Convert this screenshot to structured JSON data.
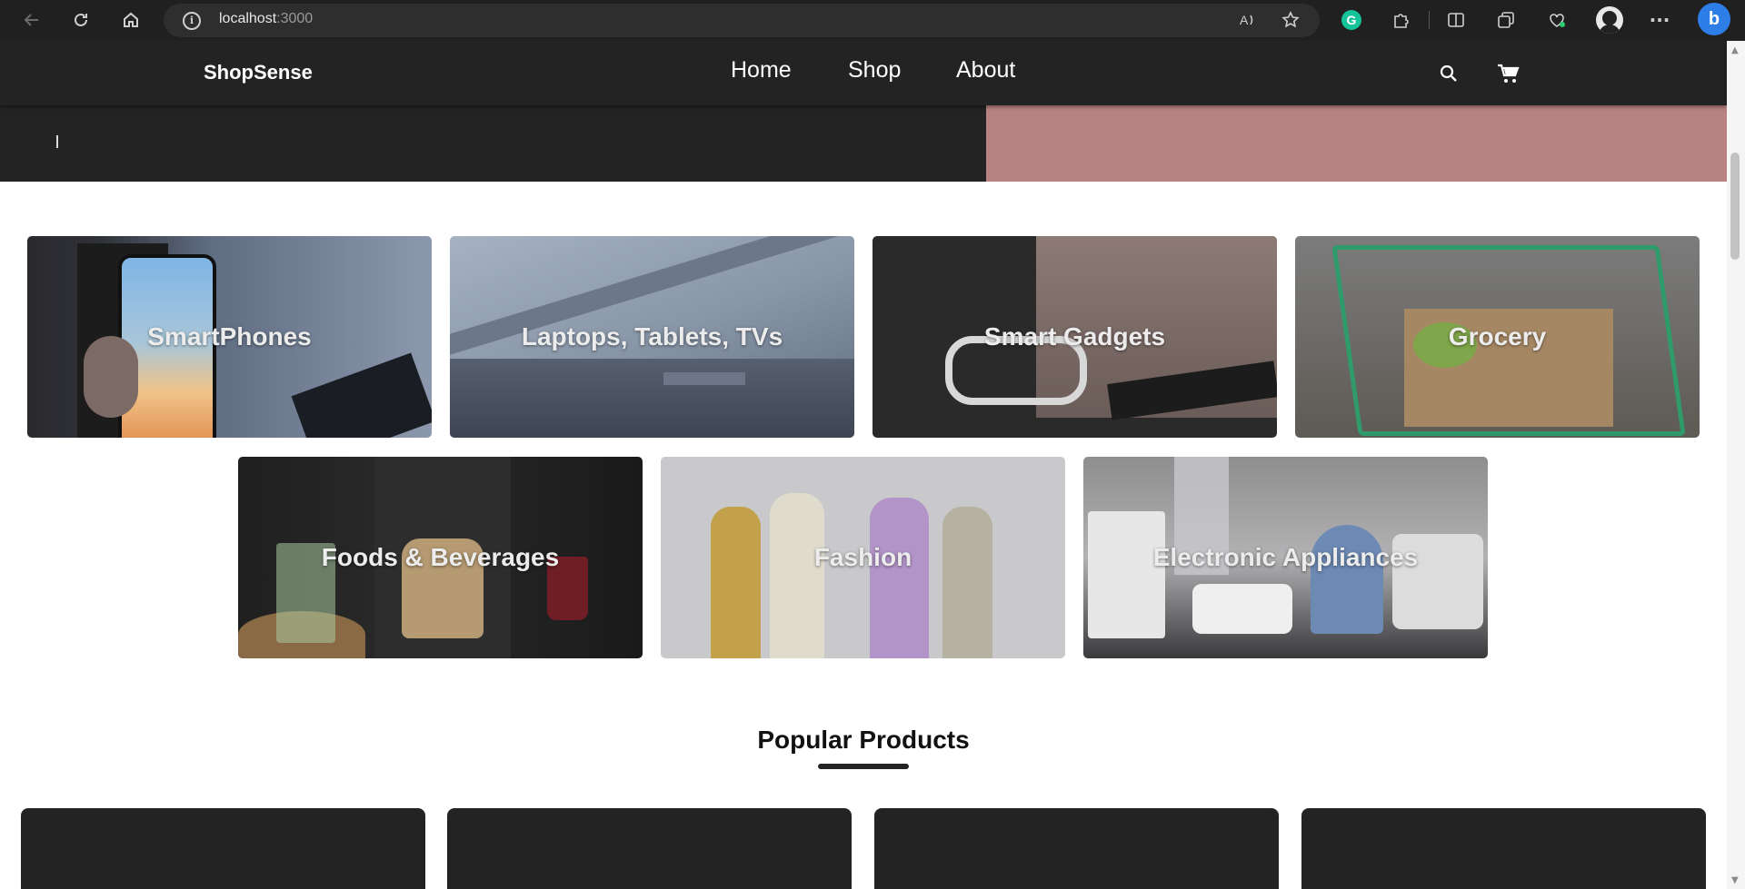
{
  "browser": {
    "url_host": "localhost",
    "url_port": ":3000",
    "back_icon": "back-arrow-icon",
    "reload_icon": "reload-icon",
    "home_icon": "home-icon",
    "grammarly_letter": "G",
    "bing_letter": "b",
    "more_label": "···"
  },
  "site": {
    "brand": "ShopSense",
    "nav": {
      "home": "Home",
      "shop": "Shop",
      "about": "About"
    },
    "search_icon": "search-icon",
    "cart_icon": "cart-icon"
  },
  "hero": {
    "left_color": "#232323",
    "right_color": "#b98282"
  },
  "categories": [
    {
      "label": "SmartPhones"
    },
    {
      "label": "Laptops, Tablets, TVs"
    },
    {
      "label": "Smart Gadgets"
    },
    {
      "label": "Grocery"
    },
    {
      "label": "Foods & Beverages"
    },
    {
      "label": "Fashion"
    },
    {
      "label": "Electronic Appliances"
    }
  ],
  "popular": {
    "title": "Popular Products"
  },
  "colors": {
    "nav_bg": "#232323",
    "card_bg": "#232323",
    "accent_pink": "#b98282"
  }
}
